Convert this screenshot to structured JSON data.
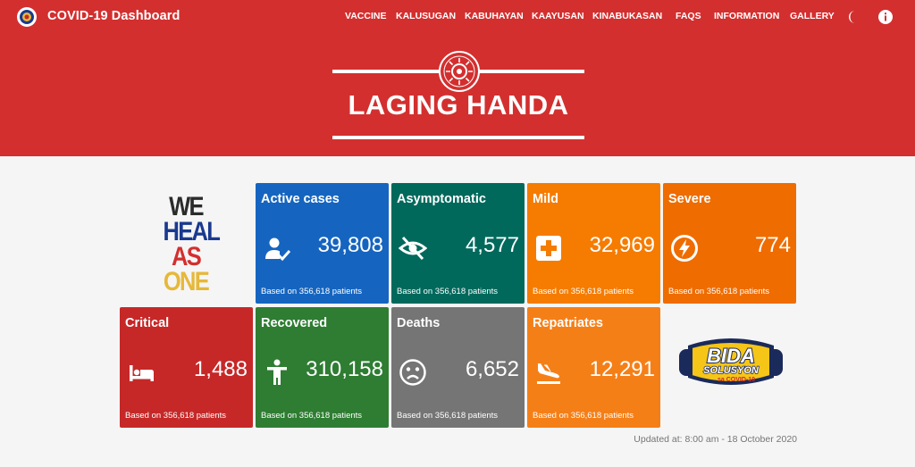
{
  "app": {
    "title": "COVID-19 Dashboard"
  },
  "nav": {
    "links": [
      "VACCINE",
      "KALUSUGAN",
      "KABUHAYAN",
      "KAAYUSAN",
      "KINABUKASAN",
      "FAQS",
      "INFORMATION",
      "GALLERY"
    ],
    "icons": [
      "dark-mode-icon",
      "info-icon"
    ]
  },
  "banner": {
    "text": "LAGING HANDA"
  },
  "slogan": {
    "lines": [
      "WE",
      "HEAL",
      "AS",
      "ONE"
    ],
    "colors": [
      "#2b2b2b",
      "#1a3a8f",
      "#d32f2f",
      "#e6b83a"
    ]
  },
  "cards": [
    {
      "title": "Active cases",
      "value": "39,808",
      "note": "Based on 356,618 patients",
      "color": "#1565c0",
      "icon": "person-check-icon"
    },
    {
      "title": "Asymptomatic",
      "value": "4,577",
      "note": "Based on 356,618 patients",
      "color": "#00695c",
      "icon": "eye-off-icon"
    },
    {
      "title": "Mild",
      "value": "32,969",
      "note": "Based on 356,618 patients",
      "color": "#f57c00",
      "icon": "medical-cross-icon"
    },
    {
      "title": "Severe",
      "value": "774",
      "note": "Based on 356,618 patients",
      "color": "#ef6c00",
      "icon": "lightning-icon"
    },
    {
      "title": "Critical",
      "value": "1,488",
      "note": "Based on 356,618 patients",
      "color": "#c62828",
      "icon": "hospital-bed-icon"
    },
    {
      "title": "Recovered",
      "value": "310,158",
      "note": "Based on 356,618 patients",
      "color": "#2e7d32",
      "icon": "person-standing-icon"
    },
    {
      "title": "Deaths",
      "value": "6,652",
      "note": "Based on 356,618 patients",
      "color": "#757575",
      "icon": "sad-face-icon"
    },
    {
      "title": "Repatriates",
      "value": "12,291",
      "note": "Based on 356,618 patients",
      "color": "#f57f17",
      "icon": "airplane-landing-icon"
    }
  ],
  "bida": {
    "line1": "BIDA",
    "line2": "SOLUSYON",
    "line3": "sa COVID-19"
  },
  "footer": {
    "updated": "Updated at: 8:00 am - 18 October 2020"
  }
}
